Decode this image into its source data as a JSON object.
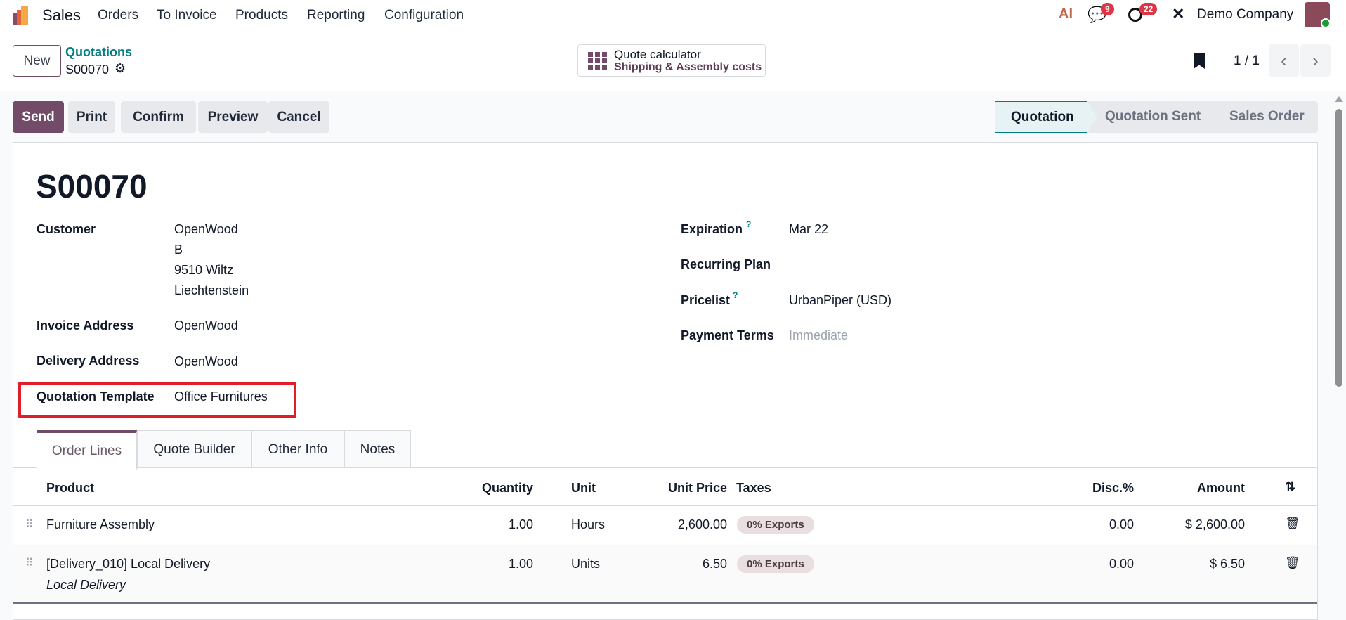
{
  "nav": {
    "app": "Sales",
    "menu": [
      "Orders",
      "To Invoice",
      "Products",
      "Reporting",
      "Configuration"
    ],
    "messages_count": "9",
    "activities_count": "22",
    "company": "Demo Company"
  },
  "control": {
    "new_label": "New",
    "breadcrumb_parent": "Quotations",
    "record": "S00070",
    "calc_title": "Quote calculator",
    "calc_sub": "Shipping & Assembly costs",
    "pager": "1 / 1"
  },
  "actions": [
    "Send",
    "Print",
    "Confirm",
    "Preview",
    "Cancel"
  ],
  "stages": [
    "Quotation",
    "Quotation Sent",
    "Sales Order"
  ],
  "form": {
    "title": "S00070",
    "customer_label": "Customer",
    "customer_lines": [
      "OpenWood",
      "B",
      "9510 Wiltz",
      "Liechtenstein"
    ],
    "invoice_label": "Invoice Address",
    "invoice_value": "OpenWood",
    "delivery_label": "Delivery Address",
    "delivery_value": "OpenWood",
    "template_label": "Quotation Template",
    "template_value": "Office Furnitures",
    "expiration_label": "Expiration",
    "expiration_value": "Mar 22",
    "recurring_label": "Recurring Plan",
    "pricelist_label": "Pricelist",
    "pricelist_value": "UrbanPiper (USD)",
    "terms_label": "Payment Terms",
    "terms_value": "Immediate",
    "help": "?"
  },
  "tabs": [
    "Order Lines",
    "Quote Builder",
    "Other Info",
    "Notes"
  ],
  "table": {
    "headers": [
      "Product",
      "Quantity",
      "Unit",
      "Unit Price",
      "Taxes",
      "Disc.%",
      "Amount"
    ],
    "rows": [
      {
        "product": "Furniture Assembly",
        "desc": "",
        "qty": "1.00",
        "unit": "Hours",
        "price": "2,600.00",
        "tax": "0% Exports",
        "disc": "0.00",
        "amount": "$ 2,600.00"
      },
      {
        "product": "[Delivery_010] Local Delivery",
        "desc": "Local Delivery",
        "qty": "1.00",
        "unit": "Units",
        "price": "6.50",
        "tax": "0% Exports",
        "disc": "0.00",
        "amount": "$ 6.50"
      }
    ]
  },
  "colors": {
    "primary": "#714b67",
    "highlight": "#e11d2a",
    "link": "#017e84"
  }
}
